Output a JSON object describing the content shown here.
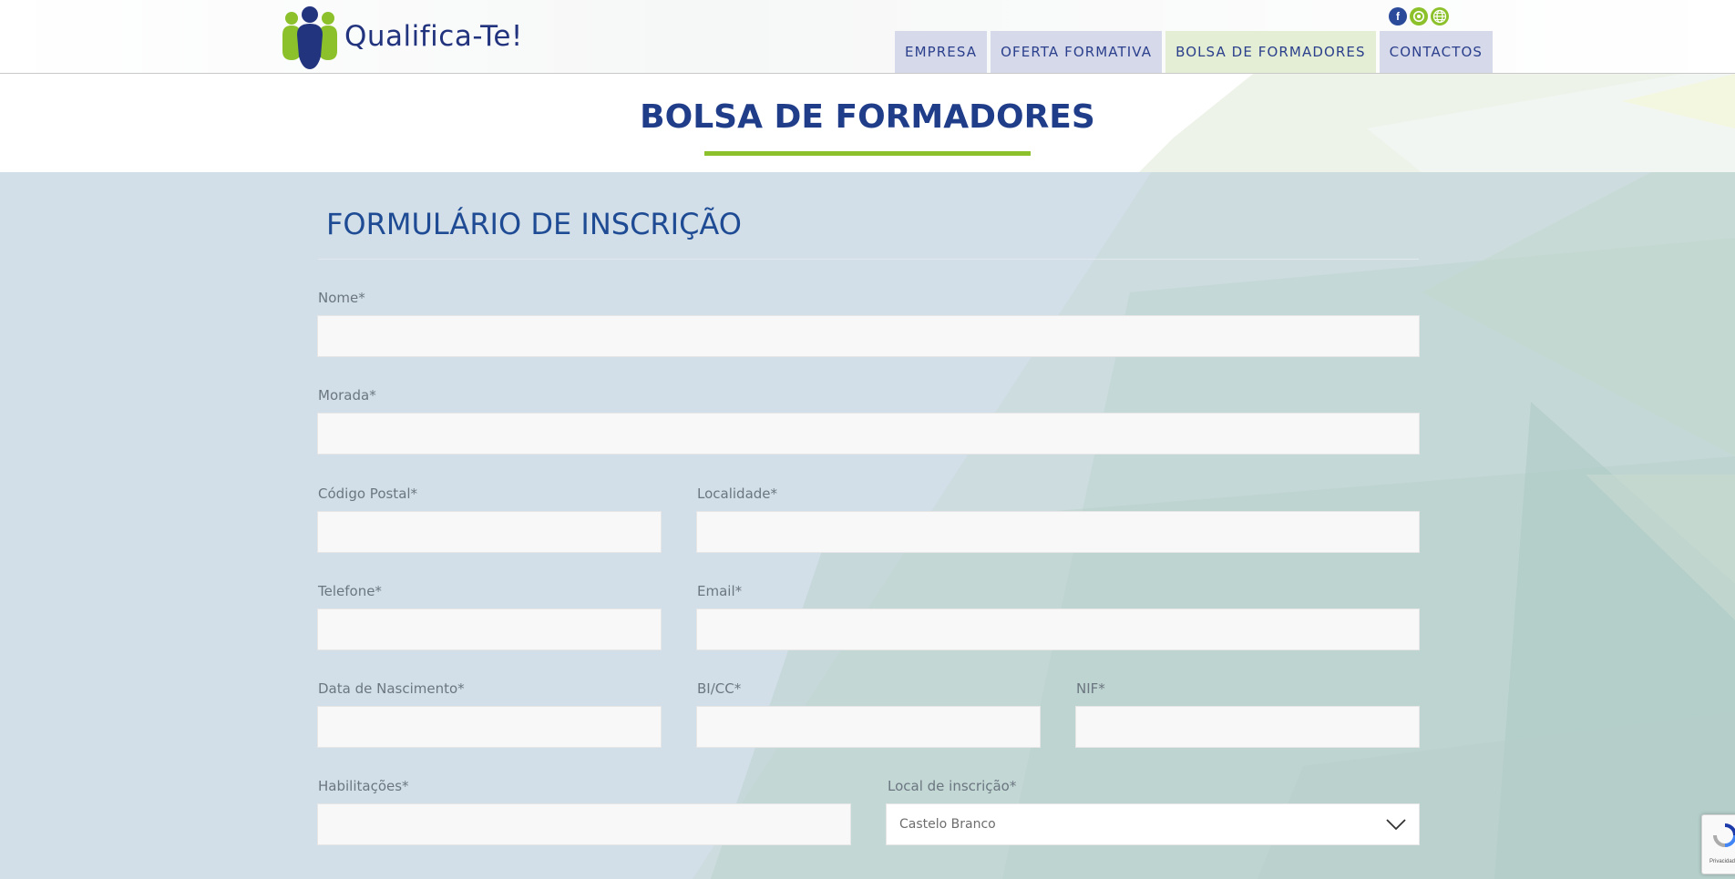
{
  "brand": {
    "name": "Qualifica-Te!"
  },
  "social": [
    {
      "icon": "facebook-icon",
      "glyph": "f",
      "color": "#2b4a9a"
    },
    {
      "icon": "email-icon",
      "glyph": "@",
      "color": "#8cc12b"
    },
    {
      "icon": "globe-icon",
      "glyph": "",
      "color": "#8cc12b"
    }
  ],
  "nav": {
    "items": [
      {
        "label": "EMPRESA",
        "active": false
      },
      {
        "label": "OFERTA FORMATIVA",
        "active": false
      },
      {
        "label": "BOLSA DE FORMADORES",
        "active": true
      },
      {
        "label": "CONTACTOS",
        "active": false
      }
    ]
  },
  "page": {
    "title": "BOLSA DE FORMADORES"
  },
  "form": {
    "title": "FORMULÁRIO DE INSCRIÇÃO",
    "fields": {
      "nome": {
        "label": "Nome*",
        "value": ""
      },
      "morada": {
        "label": "Morada*",
        "value": ""
      },
      "codigo_postal": {
        "label": "Código Postal*",
        "value": ""
      },
      "localidade": {
        "label": "Localidade*",
        "value": ""
      },
      "telefone": {
        "label": "Telefone*",
        "value": ""
      },
      "email": {
        "label": "Email*",
        "value": ""
      },
      "data_nascimento": {
        "label": "Data de Nascimento*",
        "value": ""
      },
      "bi_cc": {
        "label": "BI/CC*",
        "value": ""
      },
      "nif": {
        "label": "NIF*",
        "value": ""
      },
      "habilitacoes": {
        "label": "Habilitações*",
        "value": ""
      },
      "local_inscricao": {
        "label": "Local de inscrição*",
        "selected": "Castelo Branco"
      }
    }
  },
  "colors": {
    "brand_blue": "#203d8a",
    "accent_green": "#8cc12b",
    "form_bg": "#d2dfe9",
    "nav_bg": "#d5d9ea",
    "nav_active_bg": "#e3eed4"
  }
}
